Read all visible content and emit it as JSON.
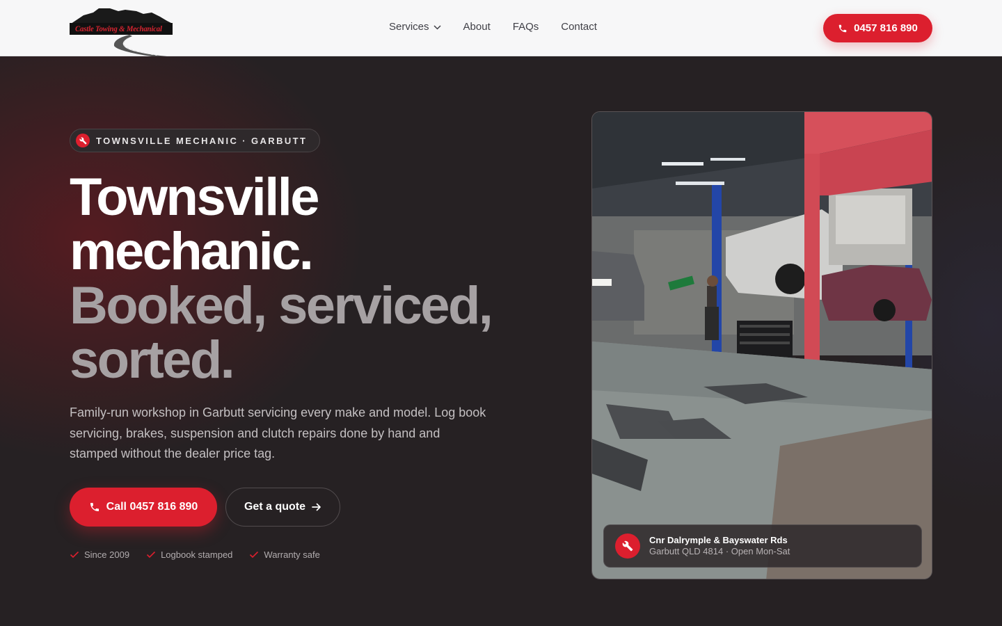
{
  "brand": {
    "logo_text": "Castle Towing & Mechanical",
    "accent": "#dc1f2e"
  },
  "nav": {
    "items": [
      {
        "label": "Services",
        "has_dropdown": true
      },
      {
        "label": "About"
      },
      {
        "label": "FAQs"
      },
      {
        "label": "Contact"
      }
    ],
    "phone": "0457 816 890"
  },
  "hero": {
    "badge": "TOWNSVILLE MECHANIC · GARBUTT",
    "headline": {
      "line1": "Townsville",
      "line2": "mechanic.",
      "line3": "Booked, serviced,",
      "line4": "sorted."
    },
    "lede": "Family-run workshop in Garbutt servicing every make and model. Log book servicing, brakes, suspension and clutch repairs done by hand and stamped without the dealer price tag.",
    "cta_call": "Call 0457 816 890",
    "cta_quote": "Get a quote",
    "checks": [
      "Since 2009",
      "Logbook stamped",
      "Warranty safe"
    ]
  },
  "location": {
    "title": "Cnr Dalrymple & Bayswater Rds",
    "subtitle": "Garbutt QLD 4814 · Open Mon-Sat"
  },
  "icons": {
    "phone": "phone-icon",
    "wrench": "wrench-icon",
    "arrow": "arrow-right-icon",
    "check": "check-icon",
    "chevron": "chevron-down-icon"
  }
}
